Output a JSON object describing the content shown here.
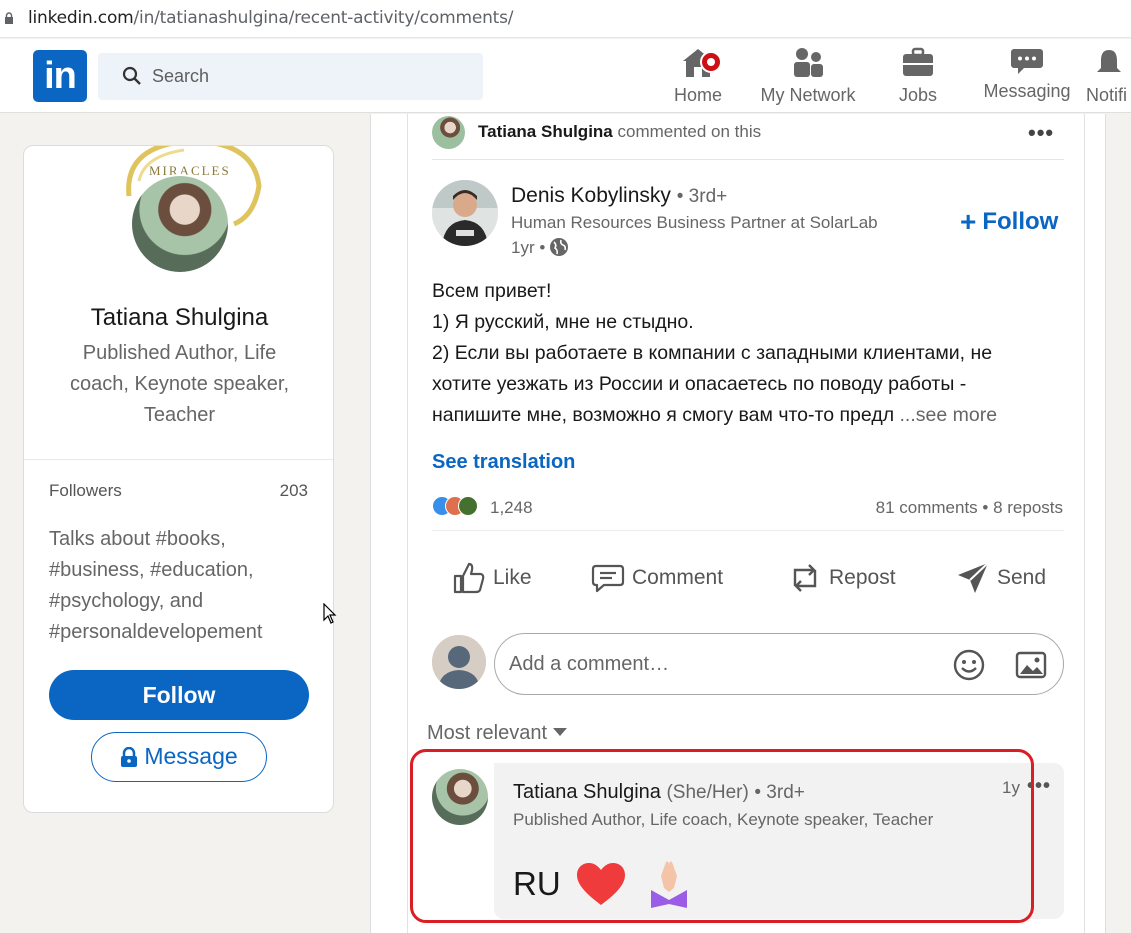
{
  "browser": {
    "url_host": "linkedin.com",
    "url_path": "/in/tatianashulgina/recent-activity/comments/"
  },
  "nav": {
    "logo": "in",
    "search_placeholder": "Search",
    "items": [
      {
        "label": "Home"
      },
      {
        "label": "My Network"
      },
      {
        "label": "Jobs"
      },
      {
        "label": "Messaging"
      },
      {
        "label": "Notifi"
      }
    ]
  },
  "profile": {
    "name": "Tatiana Shulgina",
    "headline": "Published Author, Life coach, Keynote speaker, Teacher",
    "banner_text": "MIRACLES",
    "followers_label": "Followers",
    "followers_count": "203",
    "talks_about": "Talks about #books, #business, #education, #psychology, and #personaldevelopement",
    "follow_label": "Follow",
    "message_label": "Message"
  },
  "activity": {
    "actor_name": "Tatiana Shulgina",
    "actor_action": "commented on this",
    "more": "•••"
  },
  "post": {
    "author_name": "Denis Kobylinsky",
    "author_degree": "• 3rd+",
    "author_headline": "Human Resources Business Partner at SolarLab",
    "time": "1yr •",
    "follow_label": "Follow",
    "body_line1": "Всем привет!",
    "body_line2": "1) Я русский, мне не стыдно.",
    "body_line3": "2) Если вы работаете в компании с западными клиентами, не хотите уезжать из России и опасаетесь по поводу работы - напишите мне, возможно я смогу вам что-то предл",
    "see_more": "...see more",
    "see_translation": "See translation",
    "reactions_count": "1,248",
    "social_counts": "81 comments • 8 reposts",
    "actions": {
      "like": "Like",
      "comment": "Comment",
      "repost": "Repost",
      "send": "Send"
    },
    "comment_placeholder": "Add a comment…",
    "sort_label": "Most relevant"
  },
  "comment": {
    "name": "Tatiana Shulgina",
    "pronouns": "(She/Her)",
    "degree": "• 3rd+",
    "headline": "Published Author, Life coach, Keynote speaker, Teacher",
    "time": "1y",
    "more": "•••",
    "text": "RU"
  },
  "colors": {
    "brand": "#0a66c2",
    "highlight": "#d91e26",
    "badge": "#cc1016"
  }
}
